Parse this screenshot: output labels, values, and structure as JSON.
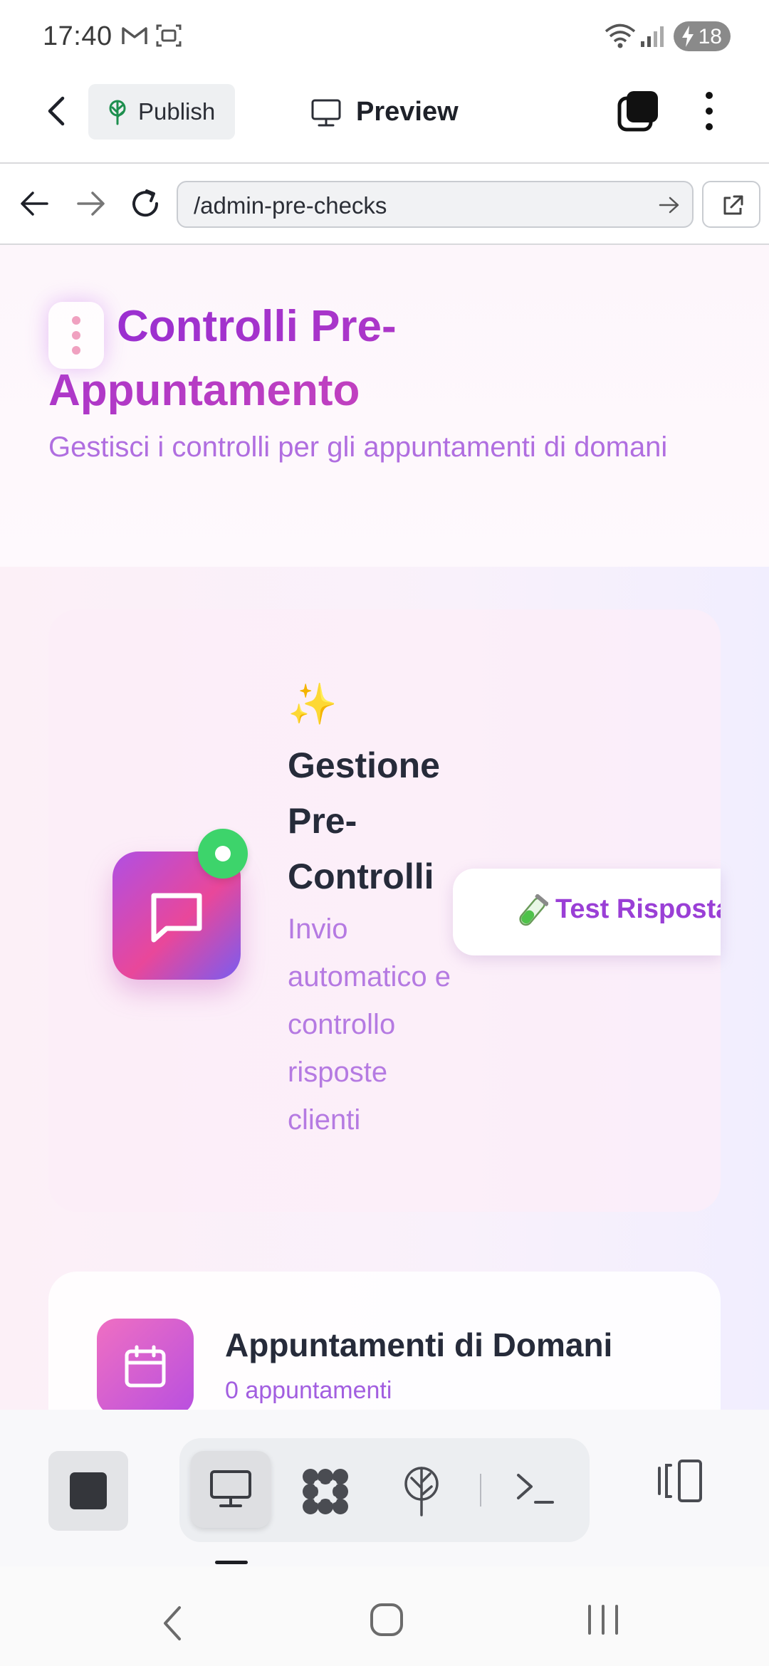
{
  "status_bar": {
    "time": "17:40",
    "battery_level": "18",
    "icons": [
      "gmail-icon",
      "screenshot-icon",
      "wifi-icon",
      "signal-icon",
      "battery-charging-icon"
    ]
  },
  "header": {
    "publish_label": "Publish",
    "preview_label": "Preview",
    "icons": [
      "back-arrow-icon",
      "publish-tree-icon",
      "monitor-icon",
      "tabs-icon",
      "more-vertical-icon"
    ]
  },
  "url_bar": {
    "url": "/admin-pre-checks",
    "icons": [
      "back-icon",
      "forward-icon",
      "reload-icon",
      "go-arrow-icon",
      "open-external-icon"
    ]
  },
  "page": {
    "title": "Controlli Pre-Appuntamento",
    "subtitle": "Gestisci i controlli per gli appuntamenti di domani",
    "hero": {
      "sparkle": "✨",
      "title": "Gestione Pre-Controlli",
      "subtitle": "Invio automatico e controllo risposte clienti",
      "test_button_icon": "🧪",
      "test_button_label": "Test Risposta",
      "status": "online"
    },
    "appointments": {
      "title": "Appuntamenti di Domani",
      "count_label": "0 appuntamenti",
      "count": 0
    }
  },
  "toolbar": {
    "items": [
      "stop-icon",
      "desktop-preview-icon",
      "plugins-icon",
      "deploy-icon",
      "terminal-icon",
      "split-view-icon"
    ],
    "active": "desktop-preview-icon"
  },
  "colors": {
    "accent_purple": "#9b2fd0",
    "subtitle_lilac": "#b06ee0",
    "online_green": "#3dd46b",
    "hero_gradient": [
      "#b04fe3",
      "#e9479a",
      "#7a5cf0"
    ]
  }
}
